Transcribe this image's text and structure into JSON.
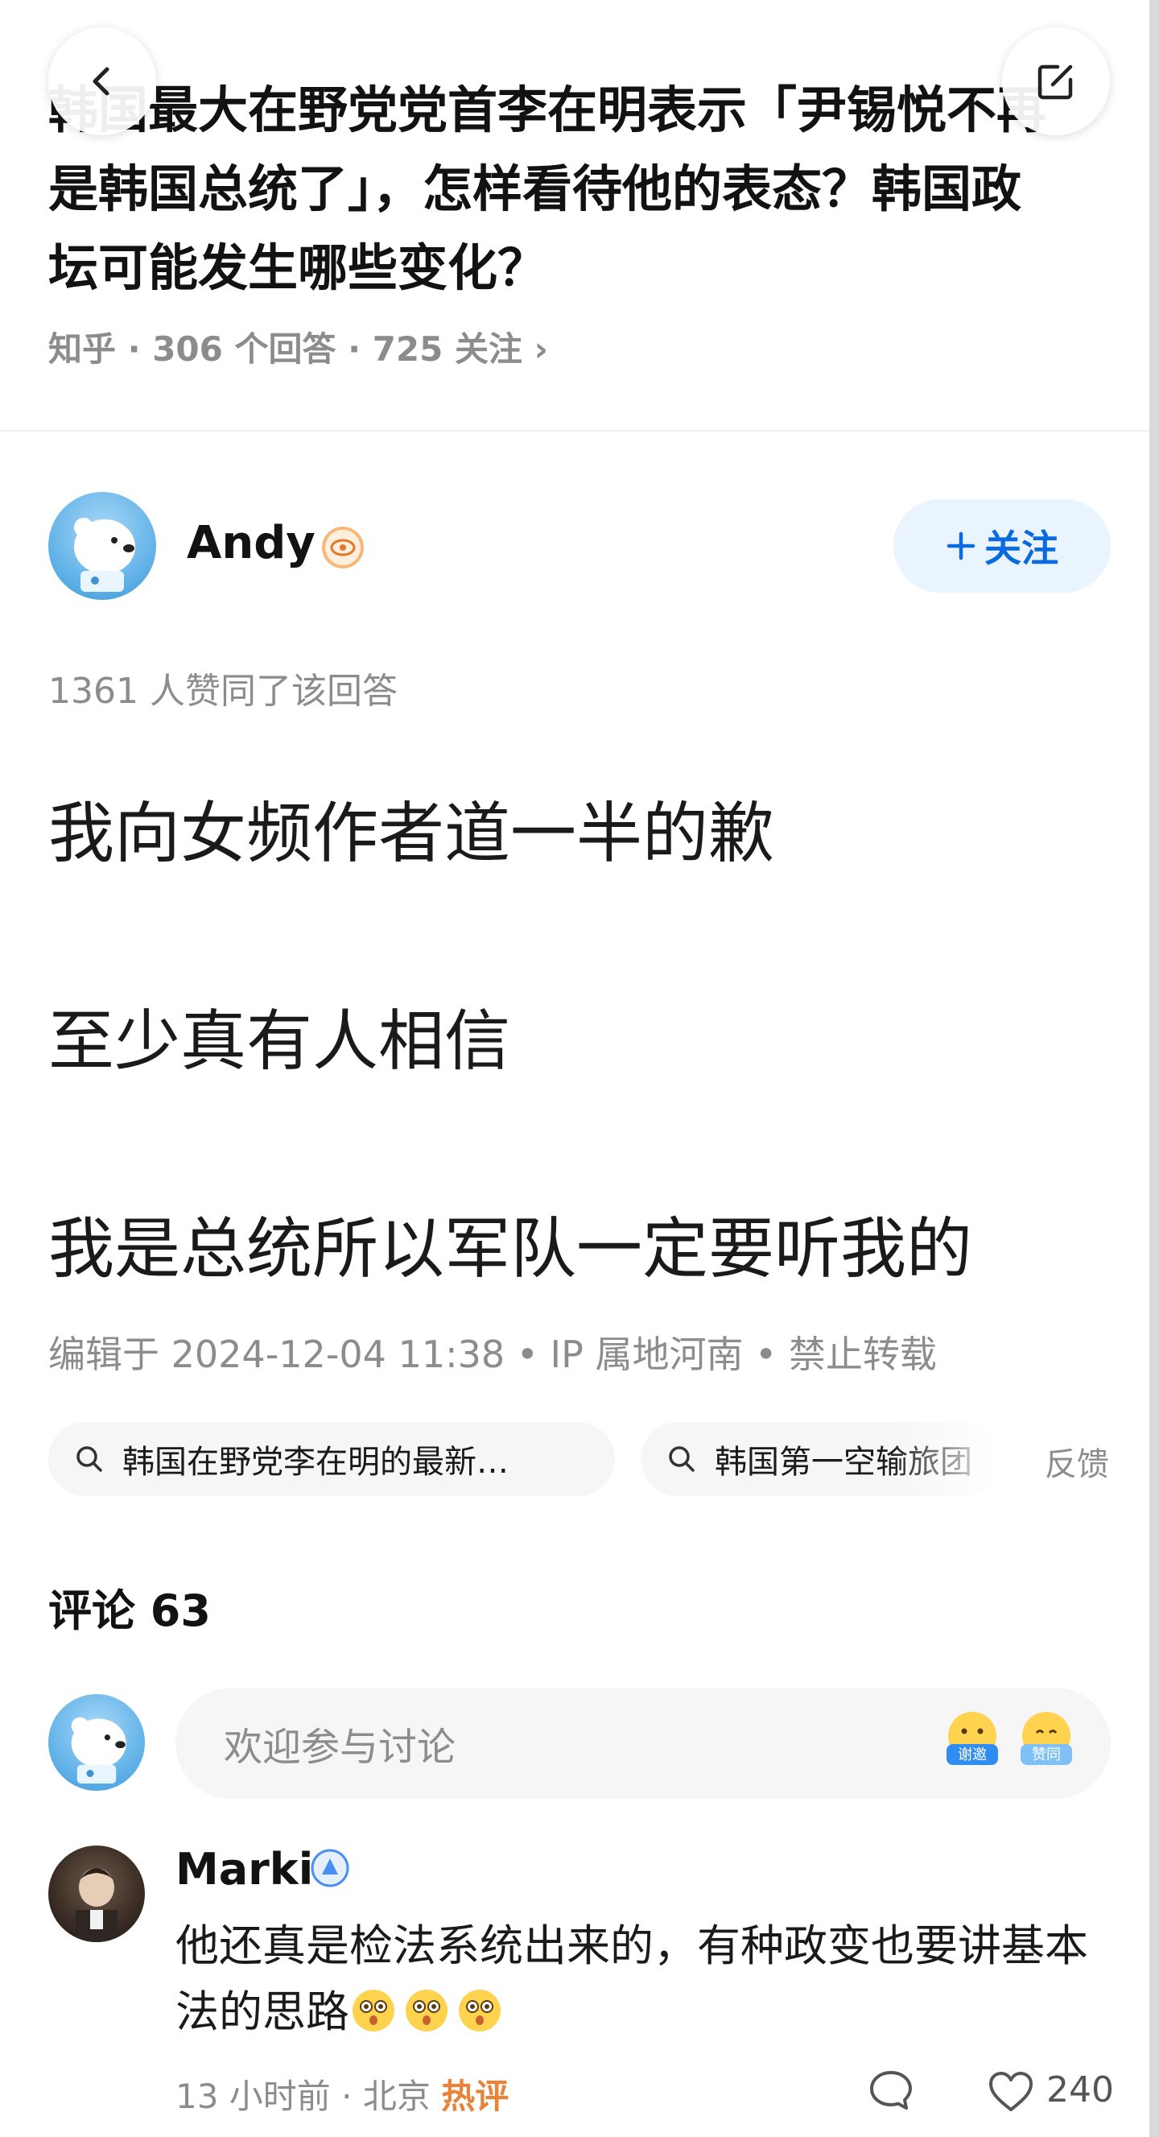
{
  "question": {
    "title": "韩国最大在野党党首李在明表示「尹锡悦不再是韩国总统了」，怎样看待他的表态？韩国政坛可能发生哪些变化？",
    "meta": "知乎 · 306 个回答 · 725 关注 ›"
  },
  "author": {
    "name": "Andy",
    "follow_label": "关注",
    "likes_text": "1361 人赞同了该回答"
  },
  "answer": {
    "paragraphs": [
      "我向女频作者道一半的歉",
      "至少真有人相信",
      "我是总统所以军队一定要听我的"
    ],
    "edit_info": "编辑于 2024-12-04 11:38 • IP 属地河南 • 禁止转载"
  },
  "search_tags": [
    "韩国在野党李在明的最新…",
    "韩国第一空输旅团"
  ],
  "feedback_label": "反馈",
  "comments": {
    "title": "评论 63",
    "input_placeholder": "欢迎参与讨论",
    "emoji_thanks": "谢邀",
    "emoji_agree": "赞同",
    "items": [
      {
        "user": "Marki",
        "text": "他还真是检法系统出来的，有种政变也要讲基本法的思路",
        "time": "13 小时前",
        "location": "北京",
        "tag": "热评",
        "likes": "240"
      }
    ]
  },
  "colors": {
    "accent": "#0a6ae0",
    "follow_bg": "#eaf4fe",
    "hot": "#e8833a",
    "muted": "#8c8c8c"
  },
  "icons": [
    "back-arrow-icon",
    "edit-icon",
    "eye-badge-icon",
    "plus-icon",
    "search-icon",
    "thanks-emoji-icon",
    "agree-emoji-icon",
    "verified-badge-icon",
    "comment-icon",
    "heart-icon"
  ]
}
